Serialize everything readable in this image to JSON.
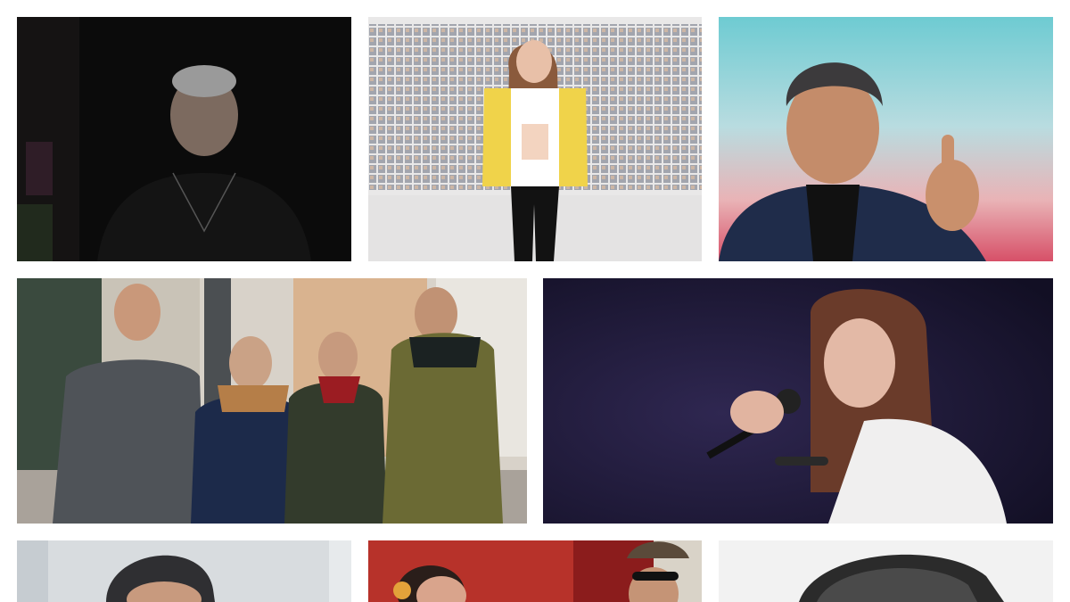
{
  "gallery": {
    "tiles": [
      {
        "id": "t1",
        "subject": "portrait-man-dark",
        "bg": "#0c0c0c"
      },
      {
        "id": "t2",
        "subject": "singer-photo-wall",
        "bg": "#eceaea"
      },
      {
        "id": "t3",
        "subject": "man-thumbs-up",
        "bg": "#7fd1d6"
      },
      {
        "id": "t4",
        "subject": "band-street",
        "bg": "#d7d3cc"
      },
      {
        "id": "t5",
        "subject": "singer-microphone",
        "bg": "#1c1738"
      },
      {
        "id": "t6",
        "subject": "man-partial",
        "bg": "#d9dde0"
      },
      {
        "id": "t7",
        "subject": "duo-red-background",
        "bg": "#c83a2f"
      },
      {
        "id": "t8",
        "subject": "man-monochrome",
        "bg": "#2a2a2a"
      }
    ]
  }
}
